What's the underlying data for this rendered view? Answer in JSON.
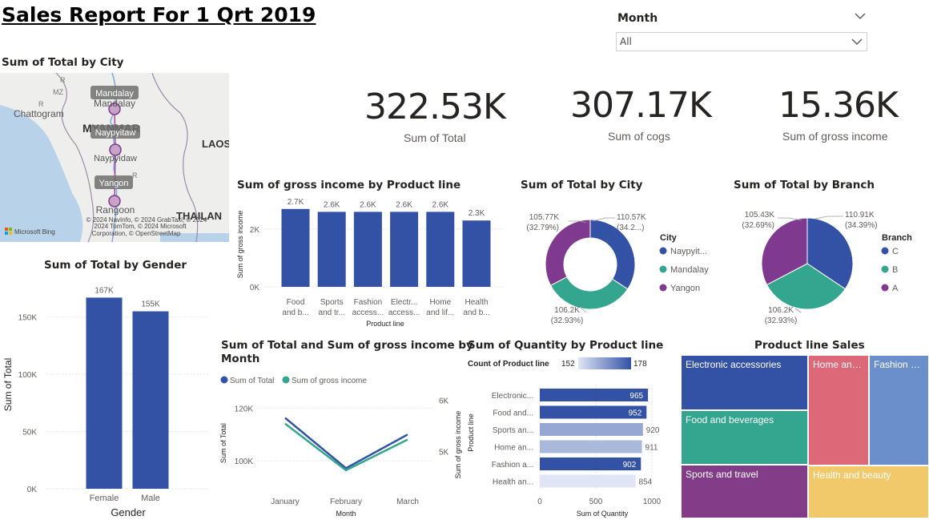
{
  "report": {
    "title": "Sales Report For 1 Qrt 2019"
  },
  "slicer": {
    "label": "Month",
    "value": "All"
  },
  "map": {
    "title": "Sum of Total by City",
    "places": {
      "mandalay_bubble": "Mandalay",
      "mandalay": "Mandalay",
      "chattogram": "Chattogram",
      "myanmar": "MYANMAR",
      "naypyitaw_bubble": "Naypyitaw",
      "naypyidaw": "Naypyidaw",
      "laos": "LAOS",
      "yangon_bubble": "Yangon",
      "rangoon": "Rangoon",
      "thailand": "THAILAN",
      "mz": "MZ",
      "r1": "R",
      "r2": "R",
      "r3": "R"
    },
    "attribution": [
      "© 2024 NavInfo, © 2024 GrabTaxi, © 2024",
      "2024 TomTom, © 2024 Microsoft",
      "Corporation, © OpenStreetMap"
    ],
    "bing": "Microsoft Bing"
  },
  "cards": [
    {
      "value": "322.53K",
      "label": "Sum of Total"
    },
    {
      "value": "307.17K",
      "label": "Sum of cogs"
    },
    {
      "value": "15.36K",
      "label": "Sum of gross income"
    }
  ],
  "colors": {
    "blue": "#3352a6",
    "teal": "#34a58f",
    "purple": "#7f3a8f",
    "pink": "#dc6878",
    "lightblue": "#6b8fcb",
    "yellow": "#f2c96a",
    "darkpurple": "#833c87"
  },
  "chart_data": [
    {
      "id": "gender",
      "type": "bar",
      "title": "Sum of Total by Gender",
      "xlabel": "Gender",
      "ylabel": "Sum of Total",
      "categories": [
        "Female",
        "Male"
      ],
      "values": [
        167000,
        155000
      ],
      "data_labels": [
        "167K",
        "155K"
      ],
      "yticks": [
        "0K",
        "50K",
        "100K",
        "150K"
      ],
      "ylim": [
        0,
        175000
      ]
    },
    {
      "id": "product_income",
      "type": "bar",
      "title": "Sum of gross income by Product line",
      "xlabel": "Product line",
      "ylabel": "Sum of gross income",
      "categories": [
        [
          "Food",
          "and b..."
        ],
        [
          "Sports",
          "and tr..."
        ],
        [
          "Fashion",
          "access..."
        ],
        [
          "Electr...",
          "access..."
        ],
        [
          "Home",
          "and lif..."
        ],
        [
          "Health",
          "and b..."
        ]
      ],
      "values": [
        2700,
        2600,
        2600,
        2600,
        2600,
        2300
      ],
      "data_labels": [
        "2.7K",
        "2.6K",
        "2.6K",
        "2.6K",
        "2.6K",
        "2.3K"
      ],
      "yticks": [
        "0K",
        "2K"
      ],
      "ylim": [
        0,
        3000
      ]
    },
    {
      "id": "city_donut",
      "type": "pie",
      "title": "Sum of Total by City",
      "legend_title": "City",
      "labels": [
        "Naypyit...",
        "Mandalay",
        "Yangon"
      ],
      "values": [
        110570,
        106200,
        105770
      ],
      "data_labels": [
        [
          "110.57K",
          "(34.2...)"
        ],
        [
          "106.2K",
          "(32.93%)"
        ],
        [
          "105.77K",
          "(32.79%)"
        ]
      ]
    },
    {
      "id": "branch_pie",
      "type": "pie",
      "title": "Sum of Total by Branch",
      "legend_title": "Branch",
      "labels": [
        "C",
        "B",
        "A"
      ],
      "values": [
        110910,
        106200,
        105430
      ],
      "data_labels": [
        [
          "110.91K",
          "(34.39%)"
        ],
        [
          "106.2K",
          "(32.93%)"
        ],
        [
          "105.43K",
          "(32.69%)"
        ]
      ]
    },
    {
      "id": "month_line",
      "type": "line",
      "title": "Sum of Total and Sum of gross income by",
      "title2": "Month",
      "xlabel": "Month",
      "ylabel": "Sum of Total",
      "categories": [
        "January",
        "February",
        "March"
      ],
      "series": [
        {
          "name": "Sum of Total",
          "values": [
            116300,
            97200,
            110000
          ]
        },
        {
          "name": "Sum of gross income",
          "values": [
            5540,
            4630,
            5230
          ]
        }
      ],
      "yticks_left": [
        "100K",
        "120K"
      ],
      "yticks_right": [
        "5K",
        "6K"
      ],
      "ylim_left": [
        90000,
        125000
      ],
      "ylim_right": [
        4300,
        6100
      ]
    },
    {
      "id": "quantity_bar",
      "type": "bar",
      "orientation": "horizontal",
      "title": "Sum of Quantity by Product line",
      "legend_title": "Count of Product line",
      "legend_min": "152",
      "legend_max": "178",
      "xlabel": "Sum of Quantity",
      "ylabel": "Product line",
      "ylabel2": "Sum of gross income",
      "categories": [
        "Electronic...",
        "Food and...",
        "Sports an...",
        "Home an...",
        "Fashion a...",
        "Health an..."
      ],
      "values": [
        965,
        952,
        920,
        911,
        902,
        854
      ],
      "counts": [
        178,
        178,
        163,
        160,
        178,
        152
      ],
      "data_labels": [
        "965",
        "952",
        "920",
        "911",
        "902",
        "854"
      ],
      "xticks": [
        "0",
        "500",
        "1000"
      ],
      "xlim": [
        0,
        1000
      ]
    },
    {
      "id": "treemap",
      "type": "treemap",
      "title": "Product line Sales",
      "labels": [
        "Electronic accessories",
        "Food and beverages",
        "Sports and travel",
        "Home and...",
        "Health and beauty",
        "Fashion ac..."
      ]
    }
  ]
}
